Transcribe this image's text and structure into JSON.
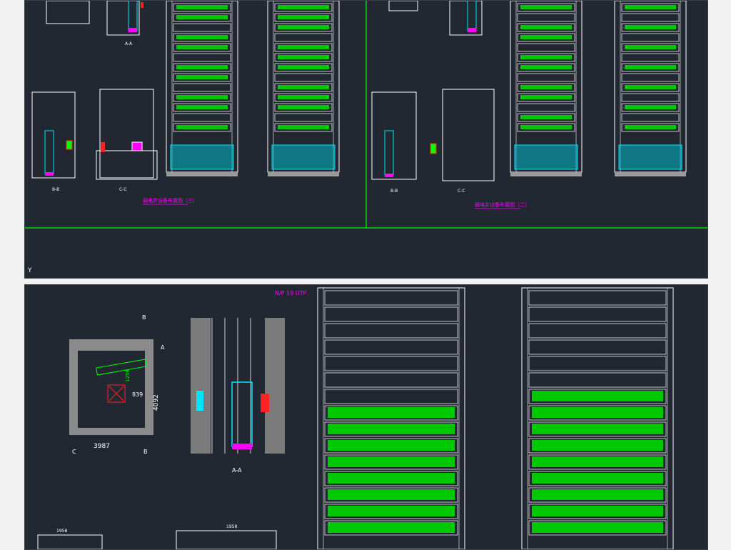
{
  "top": {
    "left_sheet": {
      "title": "弱电井设备布置图（三）",
      "section_b": "B-B",
      "section_c": "C-C",
      "section_a": "A-A"
    },
    "right_sheet": {
      "title": "弱电井设备布置图（二）",
      "section_b": "B-B",
      "section_c": "C-C"
    },
    "axis_label": "Y"
  },
  "bottom": {
    "plan": {
      "dim_width": "3987",
      "dim_depth": "4092",
      "dim_inner": "839",
      "dim_inner2": "1259",
      "marker_b_top": "B",
      "marker_a": "A",
      "marker_c": "C",
      "marker_b_bottom": "B"
    },
    "elevation": {
      "section_label": "A-A"
    },
    "rack_header": "N/P 19 UTP",
    "dim_bottom1": "1958",
    "dim_bottom2": "1958"
  },
  "colors": {
    "background": "#222831",
    "cad_green": "#00ff00",
    "cad_white": "#ffffff",
    "cad_cyan": "#00e5ff",
    "cad_magenta": "#ff00ff",
    "cad_red": "#ff2222"
  }
}
